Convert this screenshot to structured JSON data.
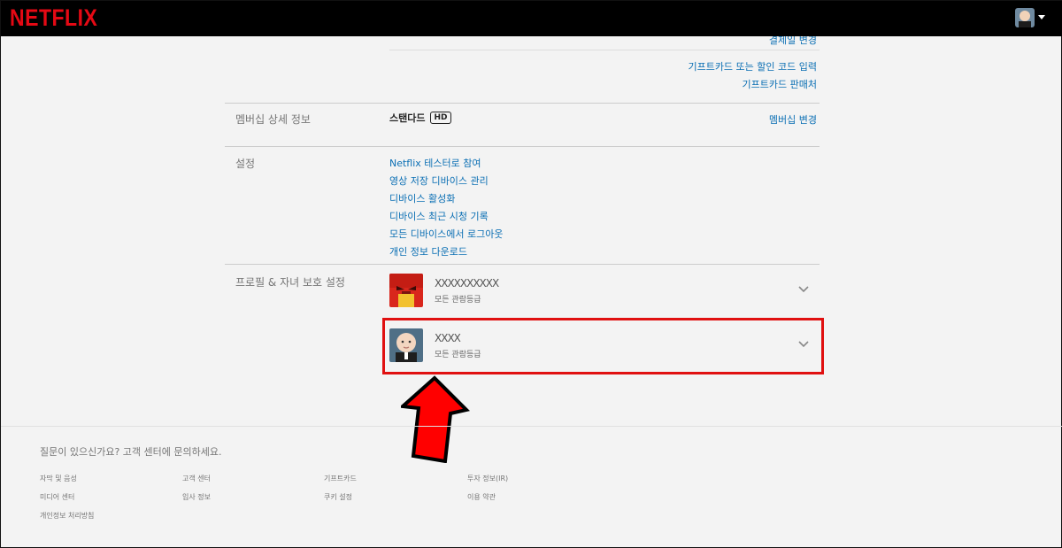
{
  "header": {
    "logo": "NETFLIX"
  },
  "billing": {
    "change_link": "결제일 변경",
    "gift_code_link": "기프트카드 또는 할인 코드 입력",
    "gift_store_link": "기프트카드 판매처"
  },
  "membership": {
    "label": "멤버십 상세 정보",
    "plan": "스탠다드",
    "quality_badge": "HD",
    "change_link": "멤버십 변경"
  },
  "settings": {
    "label": "설정",
    "links": [
      "Netflix 테스터로 참여",
      "영상 저장 디바이스 관리",
      "디바이스 활성화",
      "디바이스 최근 시청 기록",
      "모든 디바이스에서 로그아웃",
      "개인 정보 다운로드"
    ]
  },
  "profiles": {
    "label": "프로필 & 자녀 보호 설정",
    "items": [
      {
        "name": "XXXXXXXXXX",
        "rating": "모든 관람등급",
        "avatar_icon": "red-character-avatar"
      },
      {
        "name": "XXXX",
        "rating": "모든 관람등급",
        "avatar_icon": "baby-boss-avatar"
      }
    ]
  },
  "annotation": {
    "highlight_color": "#e01010",
    "arrow_color": "#ff0000"
  },
  "footer": {
    "question": "질문이 있으신가요? 고객 센터에 문의하세요.",
    "links": [
      "자막 및 음성",
      "고객 센터",
      "기프트카드",
      "투자 정보(IR)",
      "미디어 센터",
      "입사 정보",
      "쿠키 설정",
      "이용 약관",
      "개인정보 처리방침"
    ]
  }
}
